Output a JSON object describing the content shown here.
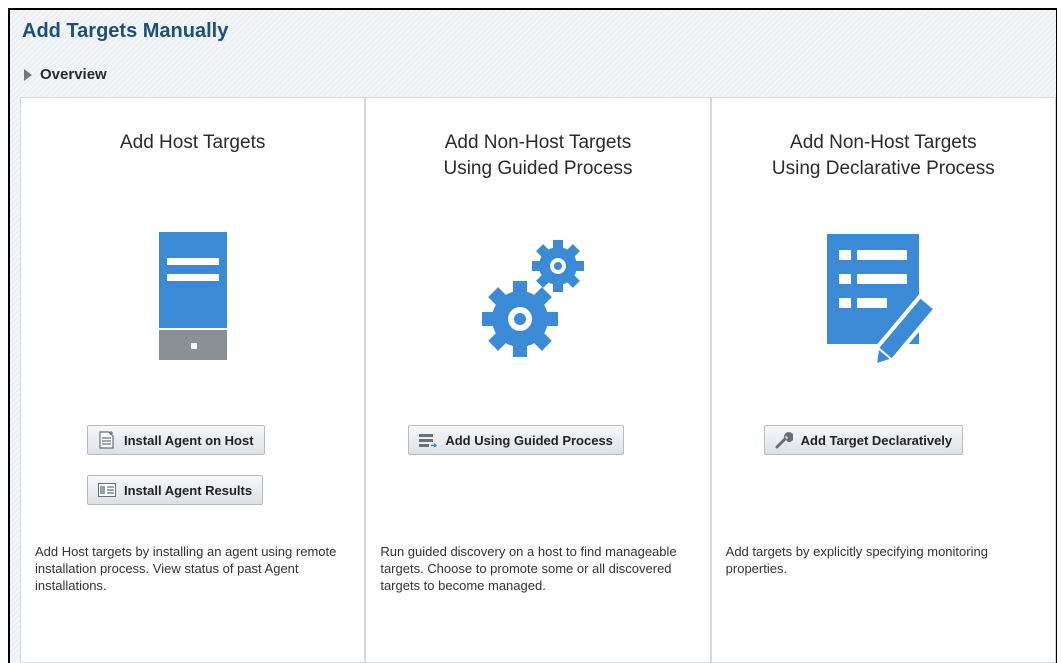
{
  "page": {
    "title": "Add Targets Manually",
    "overview_label": "Overview"
  },
  "panels": [
    {
      "title": "Add Host Targets",
      "icon": "server-icon",
      "buttons": [
        {
          "label": "Install Agent on Host",
          "icon": "document-add-icon"
        },
        {
          "label": "Install Agent Results",
          "icon": "results-list-icon"
        }
      ],
      "description": "Add Host targets by installing an agent using remote installation process. View status of past Agent installations."
    },
    {
      "title": "Add Non-Host Targets\nUsing Guided Process",
      "icon": "gears-icon",
      "buttons": [
        {
          "label": "Add Using Guided Process",
          "icon": "guided-process-icon"
        }
      ],
      "description": "Run guided discovery on a host to find manageable targets. Choose to promote some or all discovered targets to become managed."
    },
    {
      "title": "Add Non-Host Targets\nUsing Declarative Process",
      "icon": "form-edit-icon",
      "buttons": [
        {
          "label": "Add Target Declaratively",
          "icon": "wrench-icon"
        }
      ],
      "description": "Add targets by explicitly specifying monitoring properties."
    }
  ],
  "colors": {
    "title": "#1d4e7e",
    "icon_blue": "#3a8ad6",
    "icon_gray": "#8a9096"
  }
}
